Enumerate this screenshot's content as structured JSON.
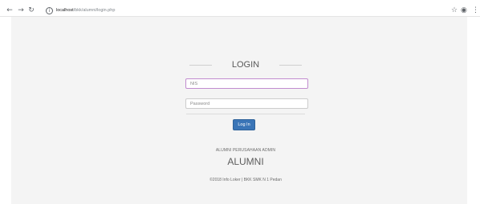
{
  "browser": {
    "url_host": "localhost",
    "url_path": "/bkk/alumni/login.php",
    "icons": {
      "back": "arrow-left-icon",
      "forward": "arrow-right-icon",
      "reload": "reload-icon",
      "info": "info-icon",
      "bookmark": "star-icon",
      "profile": "account-icon",
      "menu": "more-vert-icon"
    }
  },
  "login": {
    "title": "LOGIN",
    "username_placeholder": "NIS",
    "password_placeholder": "Password",
    "submit_label": "Log In"
  },
  "footer": {
    "company_caption": "ALUMNI PERUSAHAAN ADMIN",
    "app_name": "ALUMNI",
    "copyright": "©2018 Info Loker | BKK SMK N 1 Pedan"
  },
  "colors": {
    "page_background": "#f4f4f4",
    "button": "#3a75b7",
    "focused_border": "#c18ccf"
  }
}
